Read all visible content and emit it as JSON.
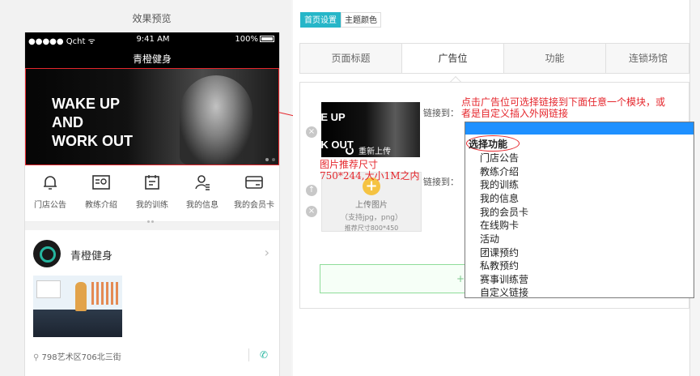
{
  "preview": {
    "title": "效果预览",
    "status_bar": {
      "left": "●●●●● Qcht ᯤ",
      "time": "9:41 AM",
      "battery": "100%"
    },
    "app_title": "青橙健身",
    "banner_text": "WAKE UP\nAND\nWORK OUT",
    "icons": [
      {
        "label": "门店公告",
        "icon": "bell-icon"
      },
      {
        "label": "教练介绍",
        "icon": "id-card-icon"
      },
      {
        "label": "我的训练",
        "icon": "calendar-icon"
      },
      {
        "label": "我的信息",
        "icon": "user-icon"
      },
      {
        "label": "我的会员卡",
        "icon": "card-icon"
      }
    ],
    "store": {
      "name": "青橙健身",
      "arrow": "›",
      "address": "798艺术区706北三街",
      "phone_icon": "✆"
    }
  },
  "editor": {
    "top_tabs": [
      "首页设置",
      "主题颜色"
    ],
    "sub_tabs": [
      "页面标题",
      "广告位",
      "功能",
      "连锁场馆"
    ],
    "ad1": {
      "thumb_text": "KE UP\nD\nRK OUT",
      "reupload": "重新上传",
      "link_label": "链接到："
    },
    "ad2": {
      "link_label": "链接到：",
      "upload": "上传图片",
      "hint1": "（支持jpg，png）",
      "hint2": "推荐尺寸800*450"
    },
    "add_button": "+实"
  },
  "dropdown": {
    "header": "选择功能",
    "items": [
      "门店公告",
      "教练介绍",
      "我的训练",
      "我的信息",
      "我的会员卡",
      "在线购卡",
      "活动",
      "团课预约",
      "私教预约",
      "赛事训练营",
      "自定义链接"
    ]
  },
  "annotations": {
    "top_line1": "点击广告位可选择链接到下面任意一个模块，或",
    "top_line2": "者是自定义插入外网链接",
    "size_line1": "图片推荐尺寸",
    "size_line2": "750*244,大小1M之内"
  },
  "colors": {
    "accent": "#26b6c8",
    "annotation": "#e5262c",
    "dropdown_highlight": "#1e90ff"
  }
}
